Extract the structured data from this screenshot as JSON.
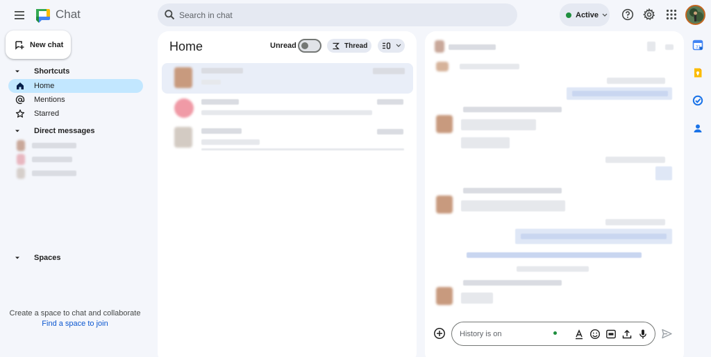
{
  "header": {
    "app_title": "Chat",
    "search_placeholder": "Search in chat",
    "status_label": "Active",
    "status_color": "#1e8e3e",
    "icons": [
      "menu-icon",
      "chat-logo",
      "search-icon",
      "chevron-down-icon",
      "help-icon",
      "settings-icon",
      "apps-grid-icon",
      "profile-avatar"
    ]
  },
  "sidebar": {
    "new_chat_label": "New chat",
    "shortcuts_heading": "Shortcuts",
    "shortcuts": [
      {
        "label": "Home",
        "icon": "home-icon",
        "active": true
      },
      {
        "label": "Mentions",
        "icon": "at-icon",
        "active": false
      },
      {
        "label": "Starred",
        "icon": "star-icon",
        "active": false
      }
    ],
    "dm_heading": "Direct messages",
    "spaces_heading": "Spaces",
    "spaces_empty_text": "Create a space to chat and collaborate",
    "spaces_join_link": "Find a space to join"
  },
  "home": {
    "title": "Home",
    "unread_label": "Unread",
    "thread_label": "Thread"
  },
  "conversation": {
    "composer_placeholder": "History is on"
  },
  "colors": {
    "accent": "#0b57d0",
    "active_nav_bg": "#c2e7ff",
    "page_bg": "#f4f6fb"
  }
}
